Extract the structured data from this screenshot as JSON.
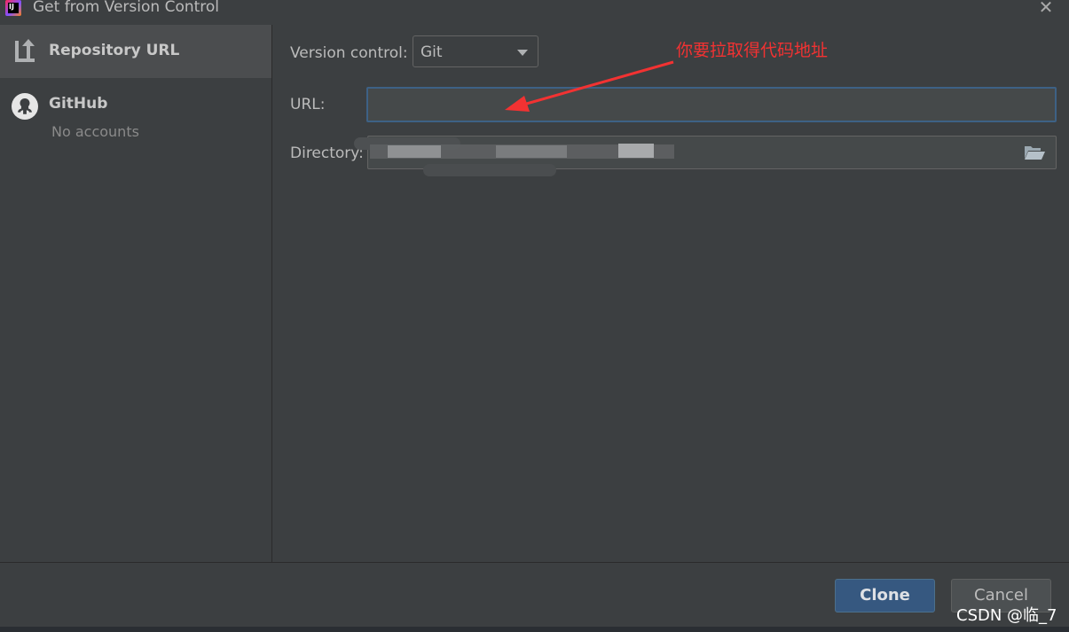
{
  "window": {
    "title": "Get from Version Control"
  },
  "sidebar": {
    "items": [
      {
        "label": "Repository URL",
        "icon": "vcs-repository-icon",
        "selected": true
      },
      {
        "label": "GitHub",
        "sublabel": "No accounts",
        "icon": "github-icon",
        "selected": false
      }
    ]
  },
  "form": {
    "version_control_label": "Version control:",
    "version_control_value": "Git",
    "url_label": "URL:",
    "url_value": "",
    "directory_label": "Directory:"
  },
  "annotation": {
    "text": "你要拉取得代码地址",
    "color": "#f23232"
  },
  "buttons": {
    "clone": "Clone",
    "cancel": "Cancel"
  },
  "watermark": "CSDN @临_7",
  "colors": {
    "accent_focus": "#3d6185",
    "primary_button": "#365880",
    "background": "#3c3f41"
  }
}
